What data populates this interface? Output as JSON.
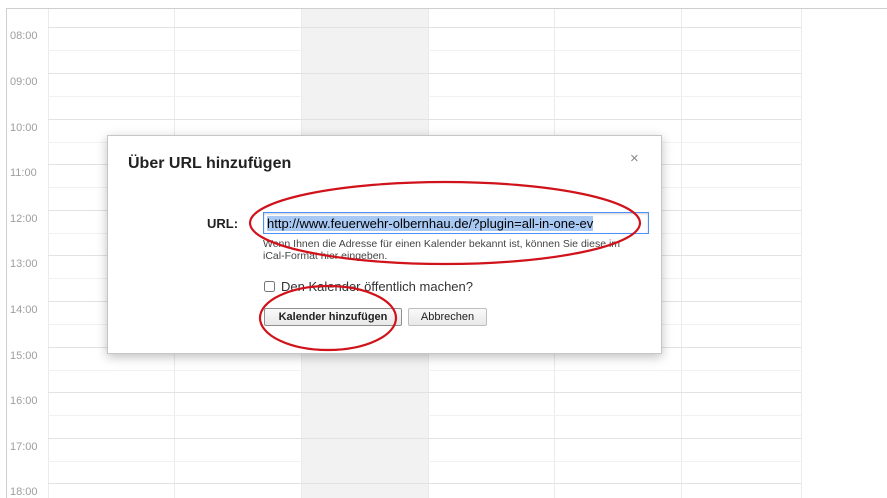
{
  "calendar": {
    "hours": [
      "08:00",
      "09:00",
      "10:00",
      "11:00",
      "12:00",
      "13:00",
      "14:00",
      "15:00",
      "16:00",
      "17:00",
      "18:00"
    ]
  },
  "dialog": {
    "title": "Über URL hinzufügen",
    "close_symbol": "×",
    "url_label": "URL:",
    "url_value": "http://www.feuerwehr-olbernhau.de/?plugin=all-in-one-ev",
    "hint": "Wenn Ihnen die Adresse für einen Kalender bekannt ist, können Sie diese im iCal-Format hier eingeben.",
    "public_checkbox_label": "Den Kalender öffentlich machen?",
    "public_checked": false,
    "add_button_label": "Kalender hinzufügen",
    "cancel_button_label": "Abbrechen"
  },
  "colors": {
    "annotation_ellipse": "#d0121b",
    "input_focus_border": "#4d90fe",
    "selection_highlight": "#a9c9f5",
    "today_column": "#f2f2f2"
  },
  "icons": {
    "close": "close-icon"
  }
}
